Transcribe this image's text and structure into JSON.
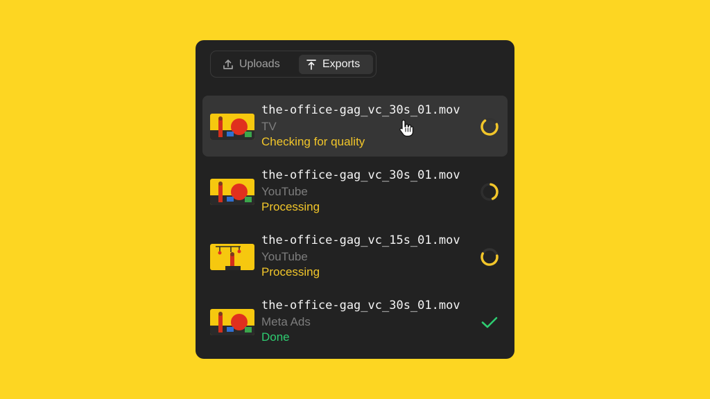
{
  "tabs": [
    {
      "label": "Uploads",
      "icon": "upload-icon",
      "active": false
    },
    {
      "label": "Exports",
      "icon": "export-icon",
      "active": true
    }
  ],
  "exports": [
    {
      "filename": "the-office-gag_vc_30s_01.mov",
      "platform": "TV",
      "status": "Checking for quality",
      "state": "in-progress",
      "progress": 0.7
    },
    {
      "filename": "the-office-gag_vc_30s_01.mov",
      "platform": "YouTube",
      "status": "Processing",
      "state": "in-progress",
      "progress": 0.4
    },
    {
      "filename": "the-office-gag_vc_15s_01.mov",
      "platform": "YouTube",
      "status": "Processing",
      "state": "in-progress",
      "progress": 0.6
    },
    {
      "filename": "the-office-gag_vc_30s_01.mov",
      "platform": "Meta Ads",
      "status": "Done",
      "state": "done",
      "progress": 1
    }
  ],
  "colors": {
    "background": "#FDD622",
    "panel": "#222222",
    "accent": "#F2C62A",
    "done": "#2ECC71"
  }
}
